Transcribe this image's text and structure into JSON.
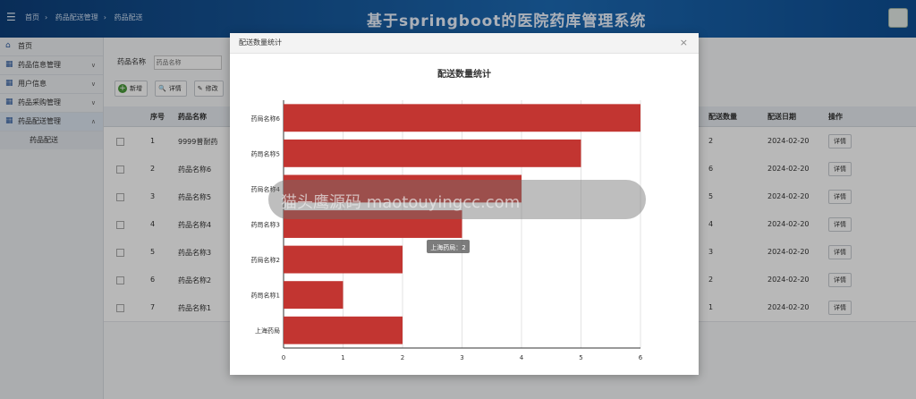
{
  "header": {
    "breadcrumb": [
      "首页",
      "药品配送管理",
      "药品配送"
    ],
    "title": "基于springboot的医院药库管理系统"
  },
  "sidebar": {
    "items": [
      {
        "label": "首页"
      },
      {
        "label": "药品信息管理"
      },
      {
        "label": "用户信息"
      },
      {
        "label": "药品采购管理"
      },
      {
        "label": "药品配送管理"
      }
    ],
    "sub_item": "药品配送"
  },
  "search": {
    "label": "药品名称",
    "placeholder": "药品名称"
  },
  "toolbar": {
    "add": "新增",
    "detail": "详情",
    "edit": "修改"
  },
  "table": {
    "headers": {
      "index": "序号",
      "name": "药品名称",
      "qty": "配送数量",
      "date": "配送日期",
      "op": "操作"
    },
    "rows": [
      {
        "index": "1",
        "name": "9999普耐药",
        "qty": "2",
        "date": "2024-02-20",
        "btn": "详情"
      },
      {
        "index": "2",
        "name": "药品名称6",
        "qty": "6",
        "date": "2024-02-20",
        "btn": "详情"
      },
      {
        "index": "3",
        "name": "药品名称5",
        "qty": "5",
        "date": "2024-02-20",
        "btn": "详情"
      },
      {
        "index": "4",
        "name": "药品名称4",
        "qty": "4",
        "date": "2024-02-20",
        "btn": "详情"
      },
      {
        "index": "5",
        "name": "药品名称3",
        "qty": "3",
        "date": "2024-02-20",
        "btn": "详情"
      },
      {
        "index": "6",
        "name": "药品名称2",
        "qty": "2",
        "date": "2024-02-20",
        "btn": "详情"
      },
      {
        "index": "7",
        "name": "药品名称1",
        "qty": "1",
        "date": "2024-02-20",
        "btn": "详情"
      }
    ]
  },
  "modal": {
    "title": "配送数量统计",
    "close": "×"
  },
  "watermark": "猫头鹰源码 maotouyingcc.com",
  "chart_data": {
    "type": "bar",
    "orientation": "horizontal",
    "title": "配送数量统计",
    "categories": [
      "药局名称6",
      "药局名称5",
      "药局名称4",
      "药局名称3",
      "药局名称2",
      "药局名称1",
      "上海药局"
    ],
    "values": [
      6,
      5,
      4,
      3,
      2,
      1,
      2
    ],
    "xlim": [
      0,
      6
    ],
    "xticks": [
      "0",
      "1",
      "2",
      "3",
      "4",
      "5",
      "6"
    ],
    "grid": true,
    "bar_color": "#c23531",
    "tooltip": "上海药局：2"
  }
}
